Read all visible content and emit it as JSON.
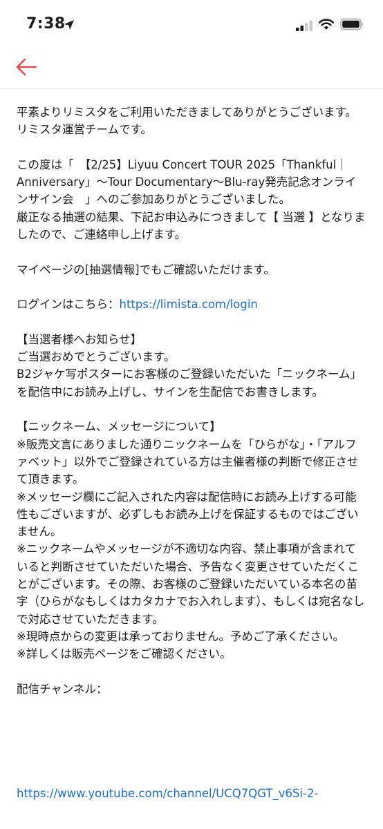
{
  "status_bar": {
    "time": "7:38",
    "icons": [
      "location-arrow-icon",
      "signal-icon",
      "wifi-icon",
      "battery-icon"
    ]
  },
  "nav": {
    "back_icon": "back-arrow-icon",
    "accent": "#e5484d"
  },
  "email": {
    "greeting_1": "平素よりリミスタをご利用いただきましてありがとうございます。",
    "greeting_2": "リミスタ運営チームです。",
    "intro_1": "この度は「　【2/25】Liyuu Concert TOUR 2025「Thankful｜Anniversary」〜Tour Documentary〜Blu-ray発売記念オンラインサイン会　」へのご参加ありがとうございました。",
    "intro_2": "厳正なる抽選の結果、下記お申込みにつきまして【 当選 】となりましたので、ご連絡申し上げます。",
    "mypage": "マイページの[抽選情報]でもご確認いただけます。",
    "login_label": "ログインはこちら：",
    "login_url": "https://limista.com/login",
    "winner_heading": "【当選者様へお知らせ】",
    "winner_1": "ご当選おめでとうございます。",
    "winner_2": "B2ジャケ写ポスターにお客様のご登録いただいた「ニックネーム」を配信中にお読み上げし、サインを生配信でお書きします。",
    "nickname_heading": "【ニックネーム、メッセージについて】",
    "note_1": "※販売文言にありました通りニックネームを「ひらがな」・「アルファベット」以外でご登録されている方は主催者様の判断で修正させて頂きます。",
    "note_2": "※メッセージ欄にご記入された内容は配信時にお読み上げする可能性もございますが、必ずしもお読み上げを保証するものではございません。",
    "note_3": "※ニックネームやメッセージが不適切な内容、禁止事項が含まれていると判断させていただいた場合、予告なく変更させていただくことがございます。その際、お客様のご登録いただいている本名の苗字（ひらがなもしくはカタカナでお入れします）、もしくは宛名なしで対応させていただきます。",
    "note_4": "※現時点からの変更は承っておりません。予めご了承ください。",
    "note_5": "※詳しくは販売ページをご確認ください。",
    "channel_label": "配信チャンネル：",
    "channel_url": "https://www.youtube.com/channel/UCQ7QGT_v6Si-2-"
  }
}
